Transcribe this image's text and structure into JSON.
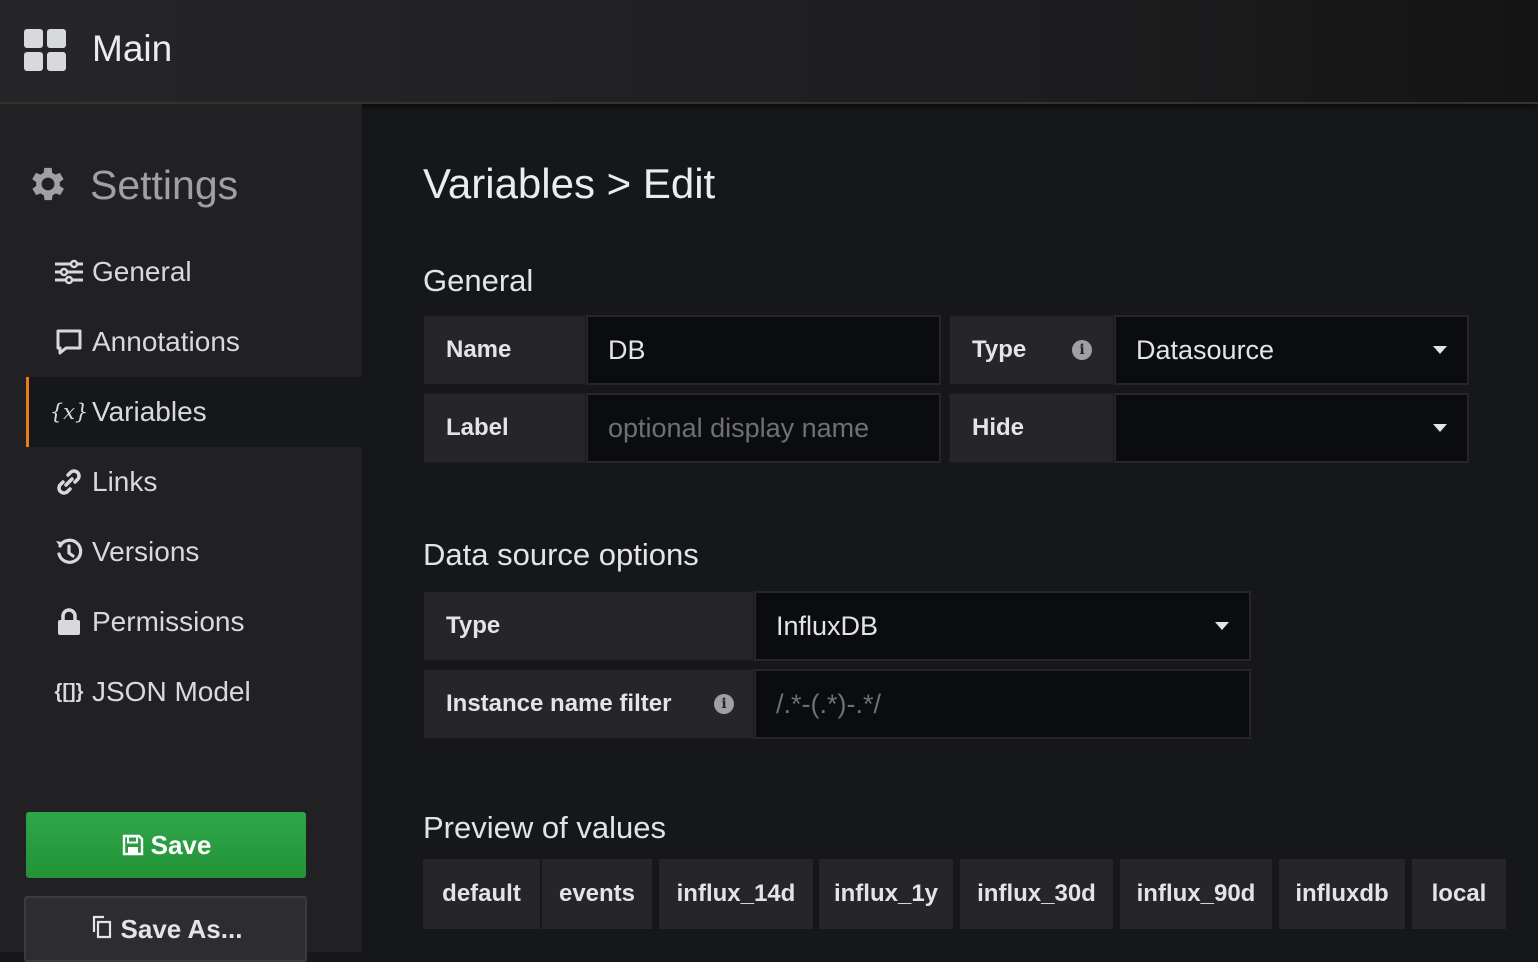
{
  "topbar": {
    "title": "Main"
  },
  "sidebar": {
    "title": "Settings",
    "items": [
      {
        "label": "General",
        "icon": "sliders-icon"
      },
      {
        "label": "Annotations",
        "icon": "comment-icon"
      },
      {
        "label": "Variables",
        "icon": "variable-icon",
        "active": true
      },
      {
        "label": "Links",
        "icon": "link-icon"
      },
      {
        "label": "Versions",
        "icon": "history-icon"
      },
      {
        "label": "Permissions",
        "icon": "lock-icon"
      },
      {
        "label": "JSON Model",
        "icon": "json-icon"
      }
    ],
    "save_label": "Save",
    "save_as_label": "Save As..."
  },
  "page": {
    "title": "Variables > Edit",
    "general": {
      "heading": "General",
      "name_label": "Name",
      "name_value": "DB",
      "type_label": "Type",
      "type_value": "Datasource",
      "label_label": "Label",
      "label_placeholder": "optional display name",
      "hide_label": "Hide",
      "hide_value": ""
    },
    "datasource": {
      "heading": "Data source options",
      "type_label": "Type",
      "type_value": "InfluxDB",
      "filter_label": "Instance name filter",
      "filter_placeholder": "/.*-(.*)-.*/"
    },
    "preview": {
      "heading": "Preview of values",
      "values": [
        "default",
        "events",
        "influx_14d",
        "influx_1y",
        "influx_30d",
        "influx_90d",
        "influxdb",
        "local"
      ]
    }
  },
  "colors": {
    "accent": "#eb7b18",
    "save_green": "#2ea64a",
    "panel": "#262628",
    "input_bg": "#0b0c0e"
  }
}
